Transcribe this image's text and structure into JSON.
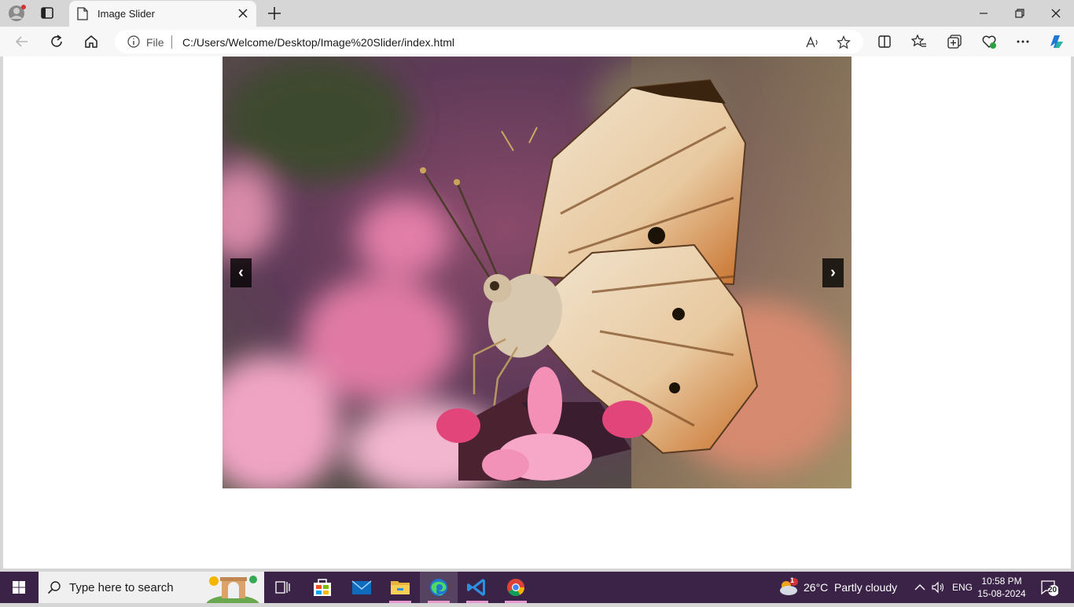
{
  "browser": {
    "tab_title": "Image Slider",
    "address_scheme_label": "File",
    "address_url": "C:/Users/Welcome/Desktop/Image%20Slider/index.html"
  },
  "slider": {
    "prev_label": "‹",
    "next_label": "›"
  },
  "taskbar": {
    "search_placeholder": "Type here to search",
    "weather_temp": "26°C",
    "weather_desc": "Partly cloudy",
    "weather_badge": "1",
    "language": "ENG",
    "time": "10:58 PM",
    "date": "15-08-2024",
    "notification_count": "20"
  },
  "colors": {
    "taskbar_bg": "#3b2347",
    "edge_blue": "#1f78d1"
  }
}
